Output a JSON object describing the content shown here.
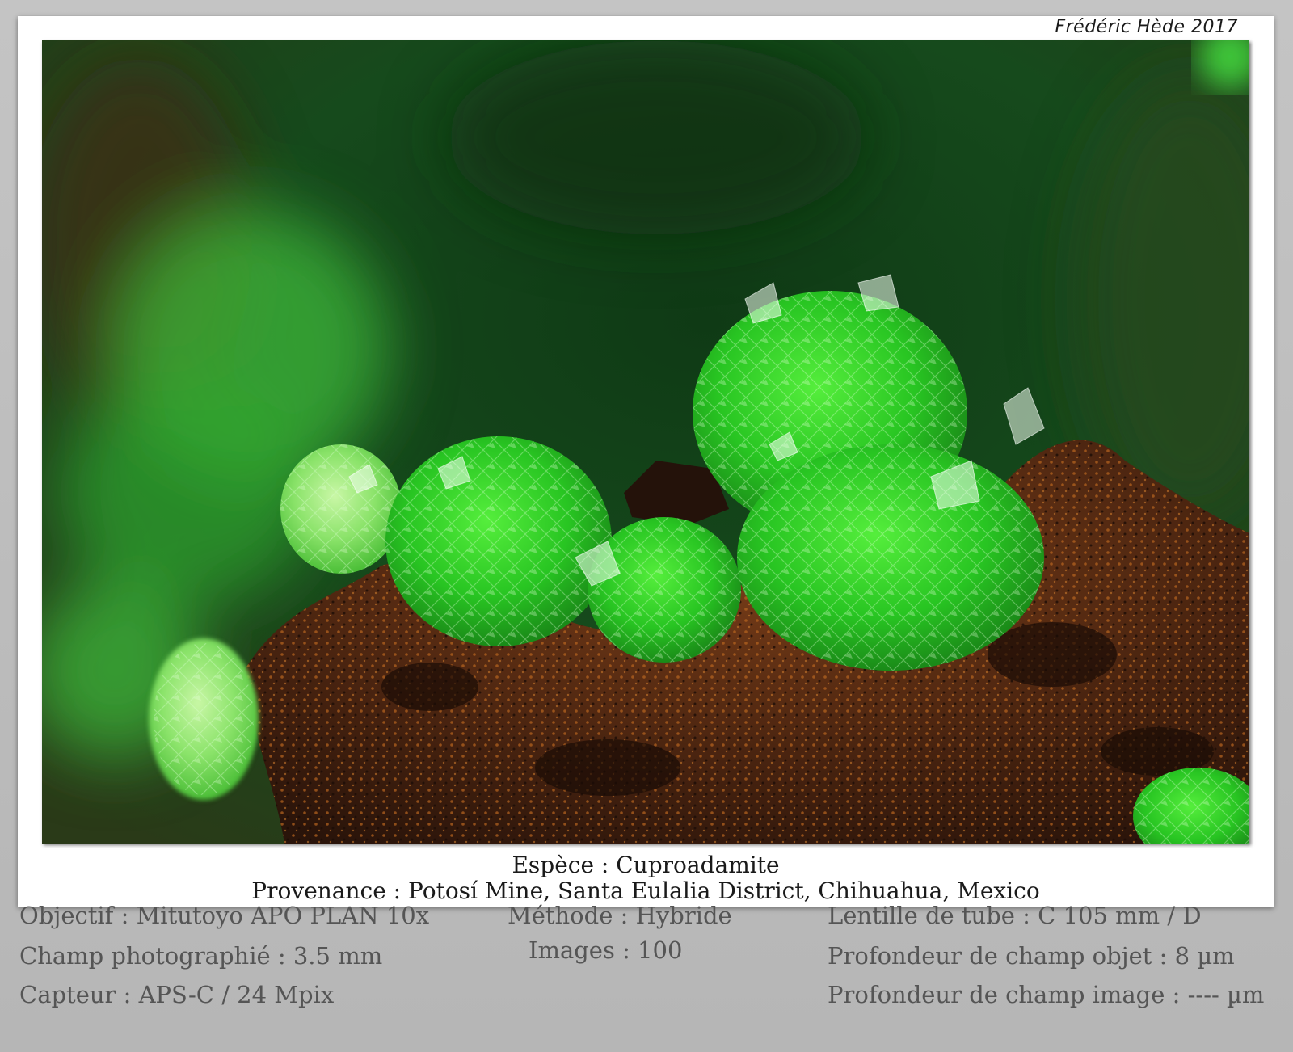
{
  "credit": "Frédéric Hède 2017",
  "caption": {
    "species": "Espèce : Cuproadamite",
    "locality": "Provenance : Potosí Mine, Santa Eulalia District, Chihuahua, Mexico"
  },
  "specs": {
    "objective": "Objectif : Mitutoyo APO PLAN 10x",
    "field": "Champ photographié : 3.5 mm",
    "sensor": "Capteur : APS-C / 24 Mpix",
    "method": "Méthode : Hybride",
    "images": "Images : 100",
    "tube_lens": "Lentille de tube : C 105 mm / D",
    "object_dof": "Profondeur de champ objet : 8 µm",
    "image_dof": "Profondeur de champ image : ---- µm"
  },
  "colors": {
    "crystal_green": "#2fd62a",
    "matrix_brown": "#5a2e14",
    "background_green": "#1e5a24"
  }
}
